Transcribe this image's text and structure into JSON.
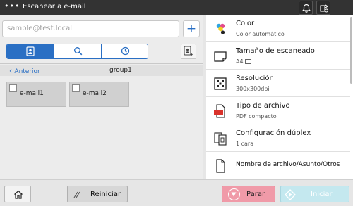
{
  "header": {
    "menu_glyph": "•••",
    "title": "Escanear  a  e-mail",
    "icons": [
      "bell-icon",
      "device-status-icon"
    ]
  },
  "destination": {
    "placeholder": "sample@test.local",
    "add_glyph": "+",
    "tabs": [
      "address-book-icon",
      "search-icon",
      "history-icon"
    ],
    "back_label": "Anterior",
    "group_name": "group1",
    "entries": [
      "e-mail1",
      "e-mail2"
    ]
  },
  "settings": [
    {
      "icon": "color-icon",
      "label": "Color",
      "value": "Color automático"
    },
    {
      "icon": "scan-size-icon",
      "label": "Tamaño de escaneado",
      "value": "A4"
    },
    {
      "icon": "resolution-icon",
      "label": "Resolución",
      "value": "300x300dpi"
    },
    {
      "icon": "pdf-file-icon",
      "label": "Tipo de archivo",
      "value": "PDF compacto"
    },
    {
      "icon": "duplex-icon",
      "label": "Configuración dúplex",
      "value": "1 cara"
    },
    {
      "icon": "file-name-icon",
      "label": "Nombre de archivo/Asunto/Otros",
      "value": ""
    }
  ],
  "footer": {
    "reset_label": "Reiniciar",
    "stop_label": "Parar",
    "start_label": "Iniciar"
  },
  "colors": {
    "accent": "#2a6fc4",
    "topbar": "#333333",
    "stop": "#f09aa8",
    "start": "#c4e8ef"
  }
}
